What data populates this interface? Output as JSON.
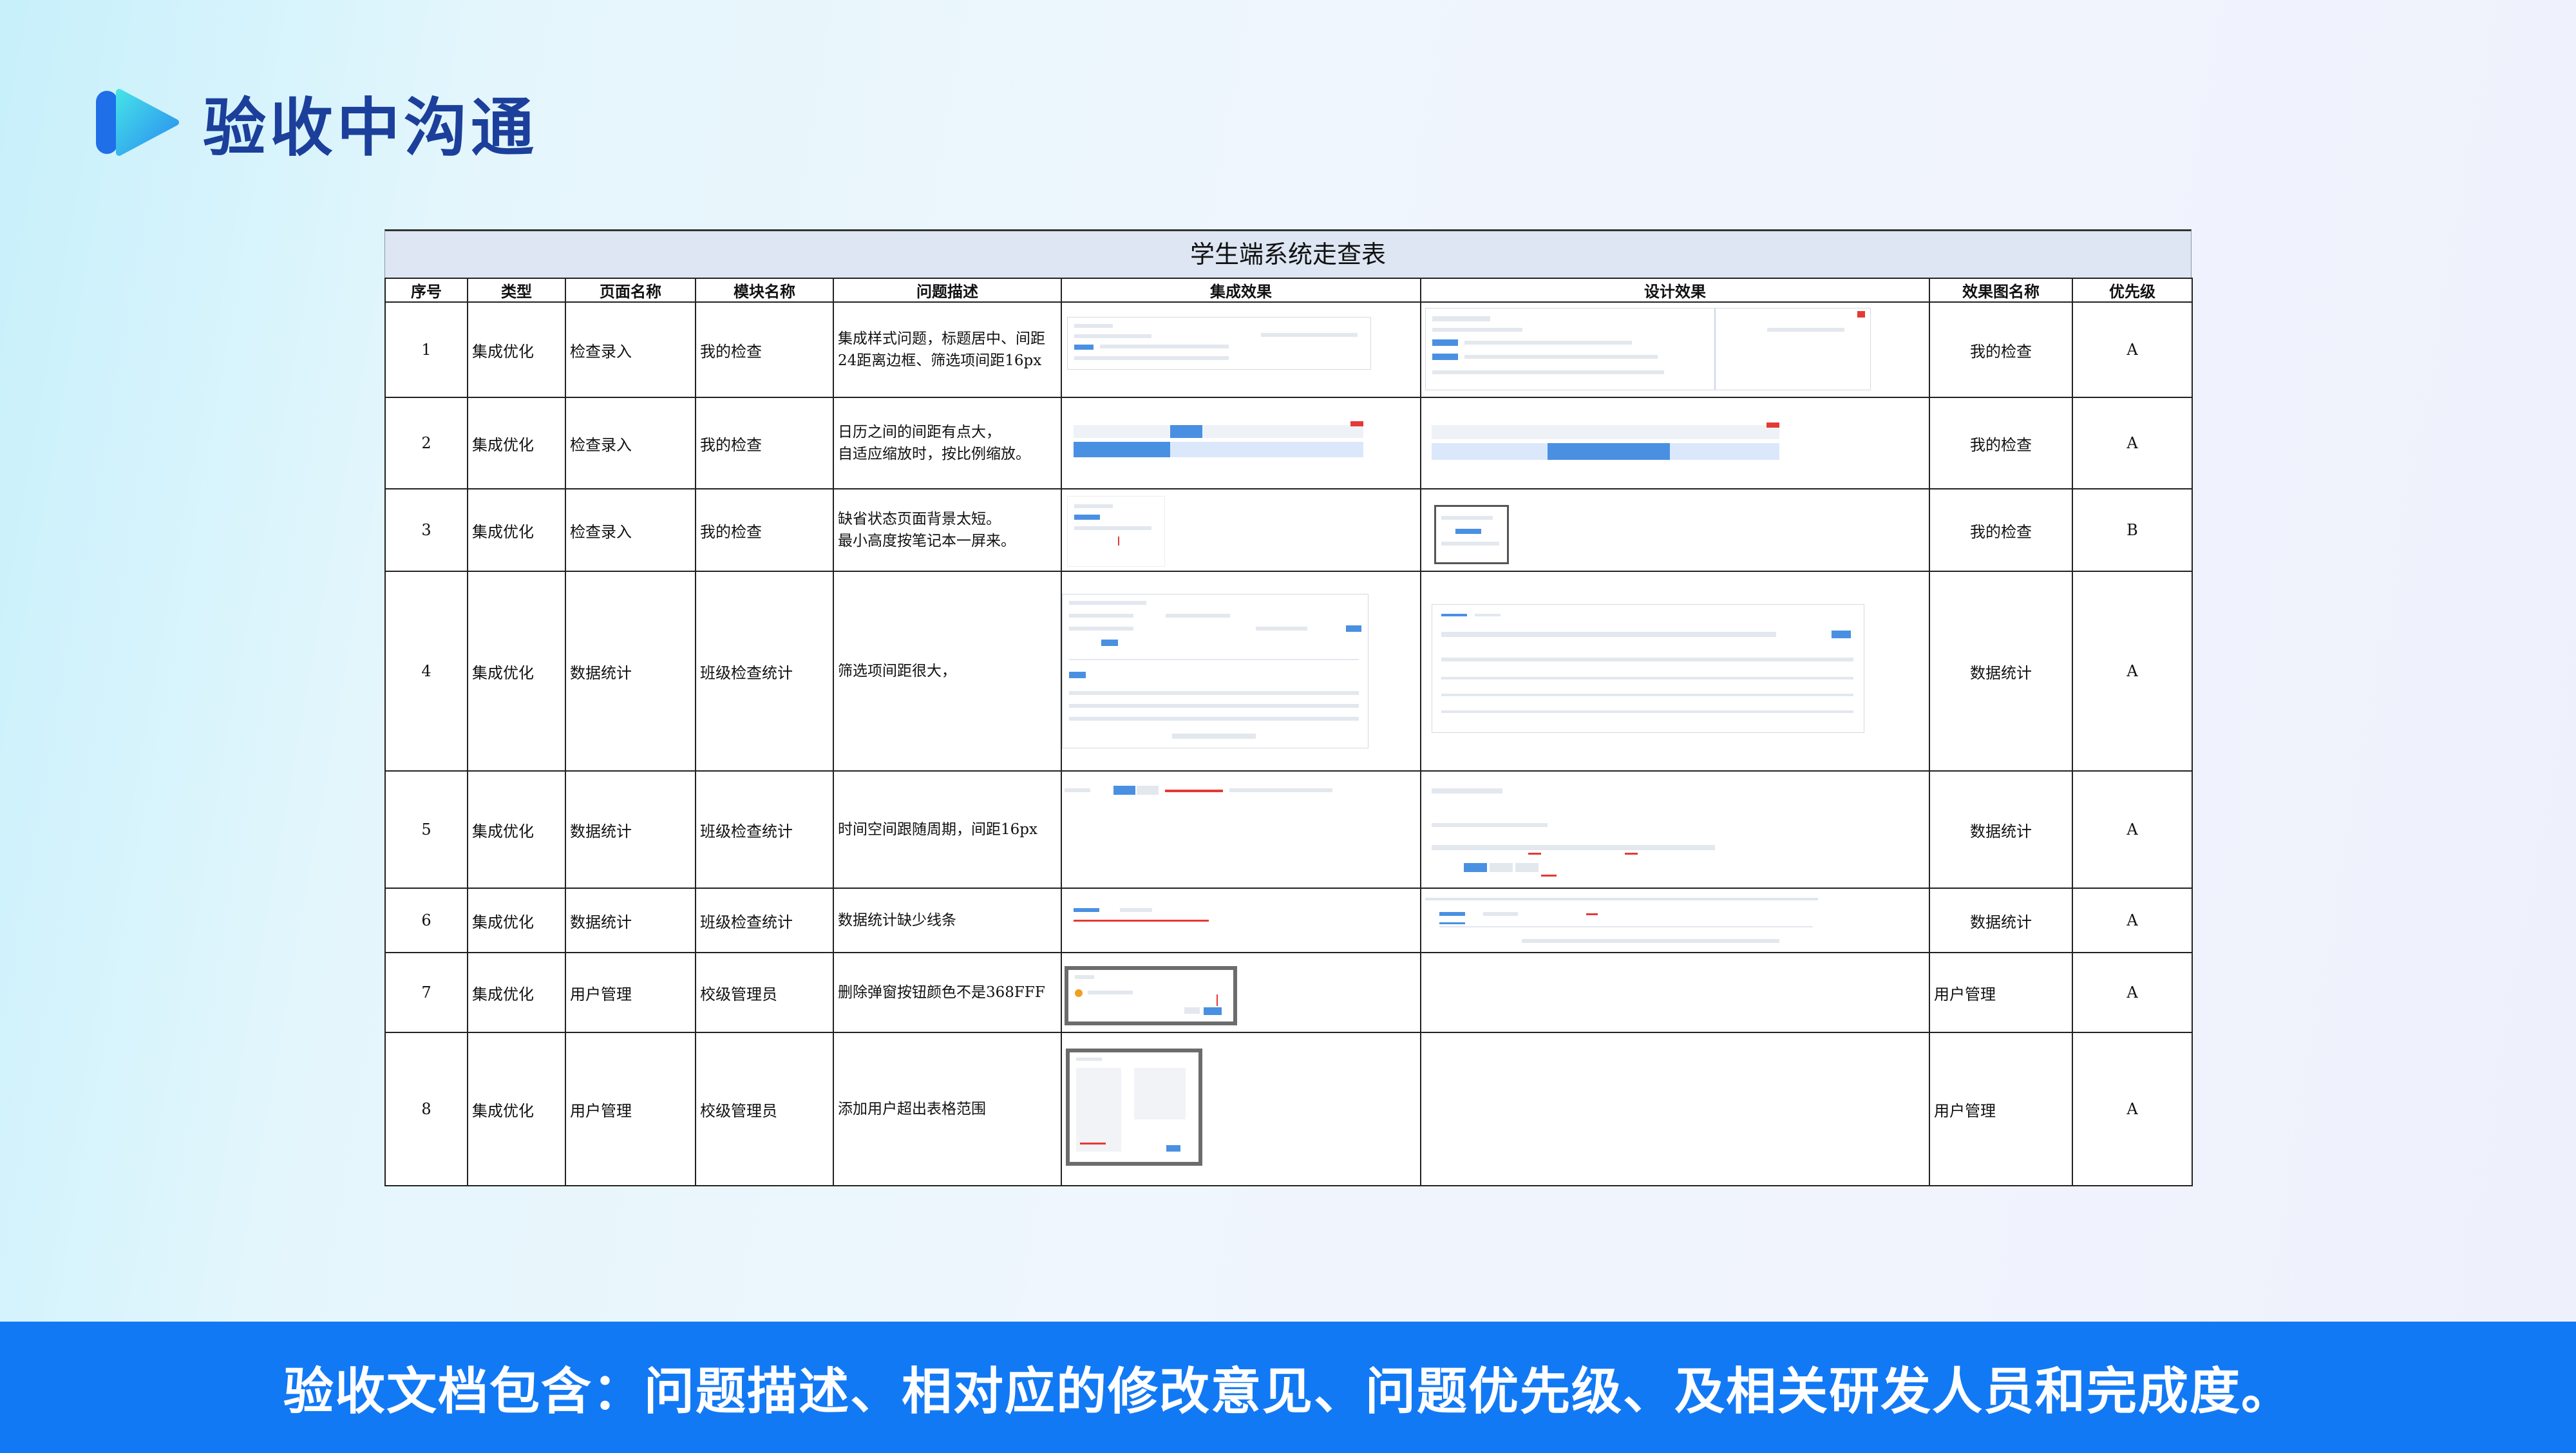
{
  "header": {
    "title": "验收中沟通",
    "logo_icon": "play-logo-icon"
  },
  "sheet": {
    "title": "学生端系统走查表",
    "columns": [
      "序号",
      "类型",
      "页面名称",
      "模块名称",
      "问题描述",
      "集成效果",
      "设计效果",
      "效果图名称",
      "优先级"
    ],
    "rows": [
      {
        "no": "1",
        "type": "集成优化",
        "page": "检查录入",
        "module": "我的检查",
        "desc": [
          "集成样式问题，标题居中、间距",
          "24距离边框、筛选项间距16px"
        ],
        "effect_name": "我的检查",
        "priority": "A"
      },
      {
        "no": "2",
        "type": "集成优化",
        "page": "检查录入",
        "module": "我的检查",
        "desc": [
          "日历之间的间距有点大，",
          "自适应缩放时，按比例缩放。"
        ],
        "effect_name": "我的检查",
        "priority": "A"
      },
      {
        "no": "3",
        "type": "集成优化",
        "page": "检查录入",
        "module": "我的检查",
        "desc": [
          "缺省状态页面背景太短。",
          "最小高度按笔记本一屏来。"
        ],
        "effect_name": "我的检查",
        "priority": "B"
      },
      {
        "no": "4",
        "type": "集成优化",
        "page": "数据统计",
        "module": "班级检查统计",
        "desc": [
          "筛选项间距很大，"
        ],
        "effect_name": "数据统计",
        "priority": "A"
      },
      {
        "no": "5",
        "type": "集成优化",
        "page": "数据统计",
        "module": "班级检查统计",
        "desc": [
          "时间空间跟随周期，间距16px"
        ],
        "effect_name": "数据统计",
        "priority": "A"
      },
      {
        "no": "6",
        "type": "集成优化",
        "page": "数据统计",
        "module": "班级检查统计",
        "desc": [
          "数据统计缺少线条"
        ],
        "effect_name": "数据统计",
        "priority": "A"
      },
      {
        "no": "7",
        "type": "集成优化",
        "page": "用户管理",
        "module": "校级管理员",
        "desc": [
          "删除弹窗按钮颜色不是368FFF"
        ],
        "effect_name": "用户管理",
        "priority": "A"
      },
      {
        "no": "8",
        "type": "集成优化",
        "page": "用户管理",
        "module": "校级管理员",
        "desc": [
          "添加用户超出表格范围"
        ],
        "effect_name": "用户管理",
        "priority": "A"
      }
    ]
  },
  "footer": {
    "text": "验收文档包含：问题描述、相对应的修改意见、问题优先级、及相关研发人员和完成度。"
  },
  "colors": {
    "brand_blue": "#1279f5",
    "title_navy": "#1b3f9a",
    "accent_cyan": "#3fd6e6",
    "sheet_title_bg": "#dde6f2"
  }
}
